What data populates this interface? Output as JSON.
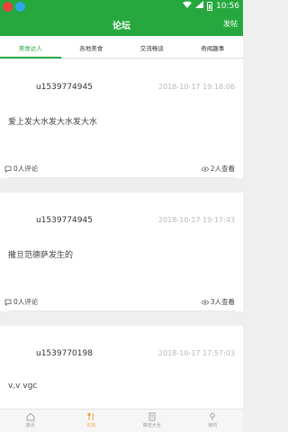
{
  "status_bar": {
    "time": "10:56"
  },
  "header": {
    "title": "论坛",
    "post_button": "发帖"
  },
  "tabs": [
    {
      "label": "美食达人",
      "active": true
    },
    {
      "label": "各地美食",
      "active": false
    },
    {
      "label": "交流畅谈",
      "active": false
    },
    {
      "label": "奇闻趣事",
      "active": false
    }
  ],
  "posts": [
    {
      "username": "u1539774945",
      "timestamp": "2018-10-17 19:18:06",
      "content": "爱上发大水发大水发大水",
      "comments": "0人评论",
      "views": "2人查看"
    },
    {
      "username": "u1539774945",
      "timestamp": "2018-10-17 19:17:43",
      "content": "撒旦范德萨发生的",
      "comments": "0人评论",
      "views": "3人查看"
    },
    {
      "username": "u1539770198",
      "timestamp": "2018-10-17 17:57:03",
      "content": "v,v vgc",
      "comments": "",
      "views": ""
    }
  ],
  "bottom_nav": [
    {
      "label": "首页",
      "icon": "home-icon",
      "active": false
    },
    {
      "label": "论坛",
      "icon": "forum-icon",
      "active": true
    },
    {
      "label": "菜谱大全",
      "icon": "recipe-icon",
      "active": false
    },
    {
      "label": "我的",
      "icon": "profile-icon",
      "active": false
    }
  ],
  "colors": {
    "brand": "#26a83f",
    "tab_active": "#2aa844",
    "nav_active": "#f2a23a"
  }
}
